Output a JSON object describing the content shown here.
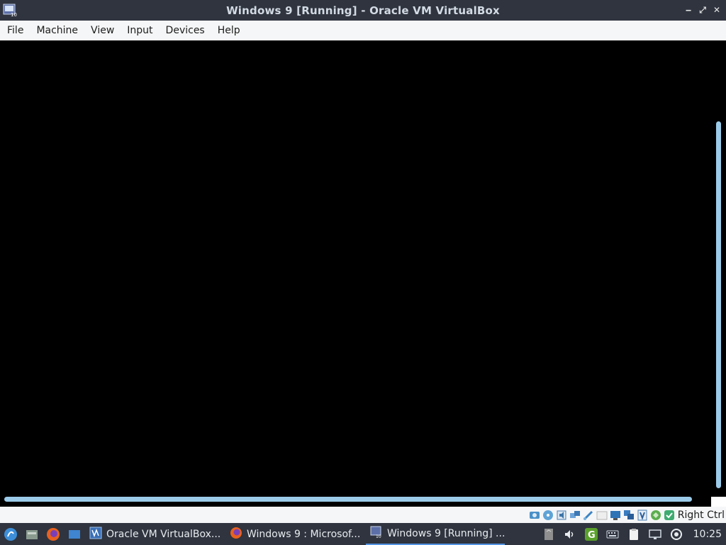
{
  "window": {
    "title": "Windows 9 [Running] - Oracle VM VirtualBox",
    "controls": {
      "minimize": "‒",
      "maximize": "⤢",
      "close": "✕"
    }
  },
  "menubar": {
    "items": [
      {
        "label": "File"
      },
      {
        "label": "Machine"
      },
      {
        "label": "View"
      },
      {
        "label": "Input"
      },
      {
        "label": "Devices"
      },
      {
        "label": "Help"
      }
    ]
  },
  "statusbar": {
    "icons": [
      "hard-disk-icon",
      "optical-drive-icon",
      "audio-icon",
      "network-icon",
      "usb-icon",
      "shared-folders-icon",
      "display-icon",
      "video-capture-icon",
      "virtualization-icon",
      "mouse-integration-icon",
      "keyboard-capture-icon"
    ],
    "host_key": "Right Ctrl"
  },
  "taskbar": {
    "launchers": [
      "start-menu-icon",
      "file-manager-icon",
      "firefox-icon",
      "show-desktop-icon"
    ],
    "tasks": [
      {
        "label": "Oracle VM VirtualBox...",
        "icon": "virtualbox-icon",
        "active": false
      },
      {
        "label": "Windows 9 : Microsof...",
        "icon": "firefox-icon",
        "active": false
      },
      {
        "label": "Windows 9 [Running] ...",
        "icon": "vm-window-icon",
        "active": true
      }
    ],
    "tray": [
      "notes-icon",
      "volume-icon",
      "update-manager-icon",
      "keyboard-icon",
      "clipboard-icon",
      "network-tray-icon",
      "settings-tray-icon"
    ],
    "clock": "10:25"
  },
  "colors": {
    "titlebar_bg": "#2f343f",
    "menubar_bg": "#f5f6f7",
    "scrollbar": "#9bcbe9",
    "accent": "#5294e2"
  }
}
